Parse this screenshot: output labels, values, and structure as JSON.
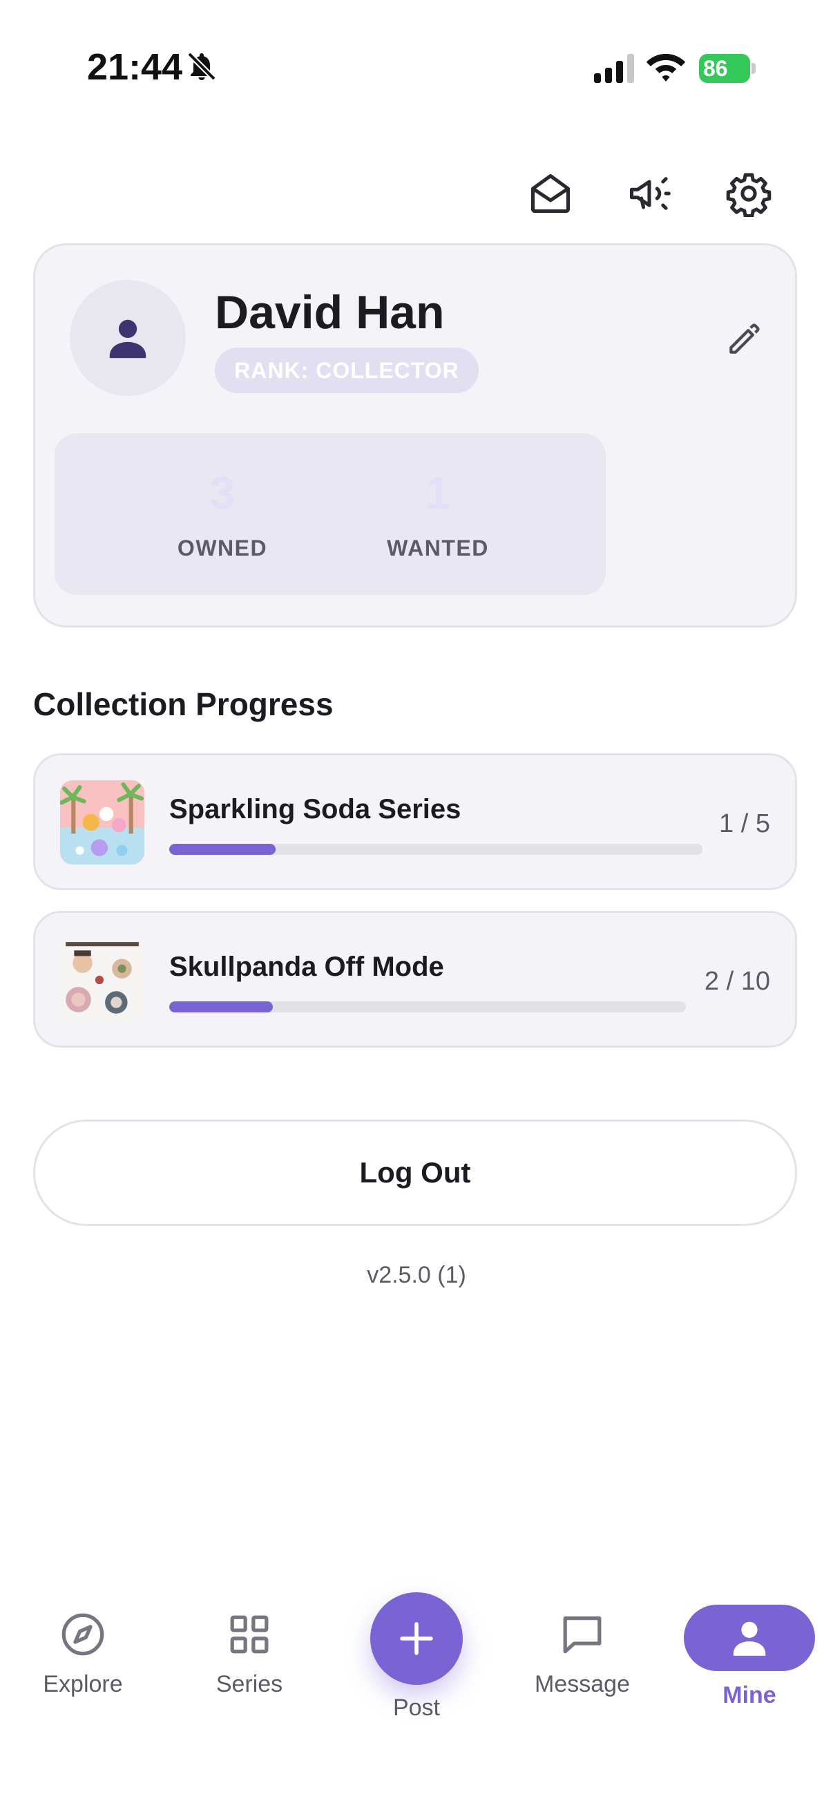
{
  "status_bar": {
    "time": "21:44",
    "battery": "86",
    "icons": [
      "bell-off-icon",
      "signal-icon",
      "wifi-icon",
      "battery-icon"
    ]
  },
  "header": {
    "icons": [
      "mail-open-icon",
      "megaphone-icon",
      "gear-icon"
    ]
  },
  "profile": {
    "name": "David Han",
    "rank": "RANK: COLLECTOR",
    "avatar_icon": "person-icon",
    "edit_icon": "pencil-icon",
    "stats": [
      {
        "value": "3",
        "label": "OWNED"
      },
      {
        "value": "1",
        "label": "WANTED"
      }
    ]
  },
  "collection": {
    "title": "Collection Progress",
    "series": [
      {
        "name": "Sparkling Soda Series",
        "owned": 1,
        "total": 5,
        "count_text": "1 / 5",
        "progress": 0.2
      },
      {
        "name": "Skullpanda Off Mode",
        "owned": 2,
        "total": 10,
        "count_text": "2 / 10",
        "progress": 0.2
      }
    ]
  },
  "logout_label": "Log Out",
  "version": "v2.5.0 (1)",
  "nav": {
    "tabs": [
      {
        "label": "Explore",
        "icon": "compass-icon"
      },
      {
        "label": "Series",
        "icon": "grid-icon"
      },
      {
        "label": "Post",
        "icon": "plus-icon"
      },
      {
        "label": "Message",
        "icon": "chat-bubble-icon"
      },
      {
        "label": "Mine",
        "icon": "person-icon"
      }
    ],
    "active": "Mine"
  },
  "colors": {
    "accent": "#7a64d3",
    "card_bg": "#f4f3f8",
    "battery_green": "#34c759"
  }
}
